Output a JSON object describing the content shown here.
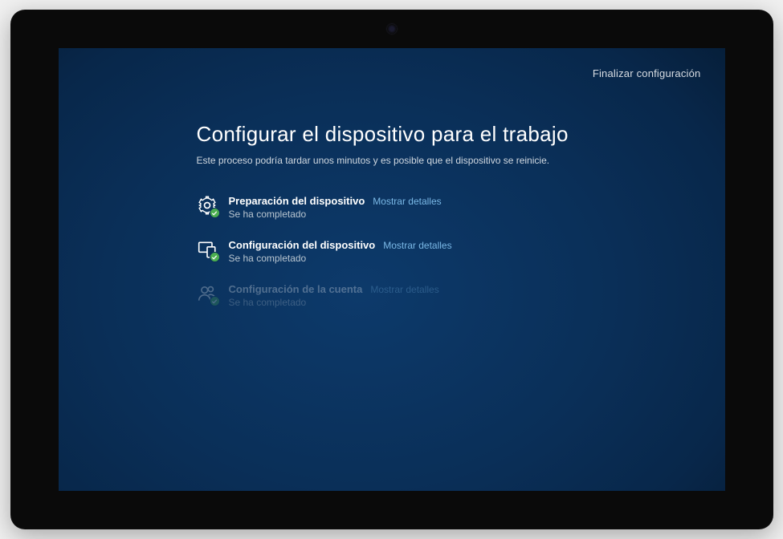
{
  "header": {
    "finish_link": "Finalizar configuración"
  },
  "title": "Configurar el dispositivo para el trabajo",
  "subtitle": "Este proceso podría tardar unos minutos y es posible que el dispositivo se reinicie.",
  "steps": [
    {
      "icon": "gear-icon",
      "label": "Preparación del dispositivo",
      "details_link": "Mostrar detalles",
      "status": "Se ha completado",
      "completed": true,
      "dimmed": false
    },
    {
      "icon": "device-icon",
      "label": "Configuración del dispositivo",
      "details_link": "Mostrar detalles",
      "status": "Se ha completado",
      "completed": true,
      "dimmed": false
    },
    {
      "icon": "account-icon",
      "label": "Configuración de la cuenta",
      "details_link": "Mostrar detalles",
      "status": "Se ha completado",
      "completed": true,
      "dimmed": true
    }
  ]
}
